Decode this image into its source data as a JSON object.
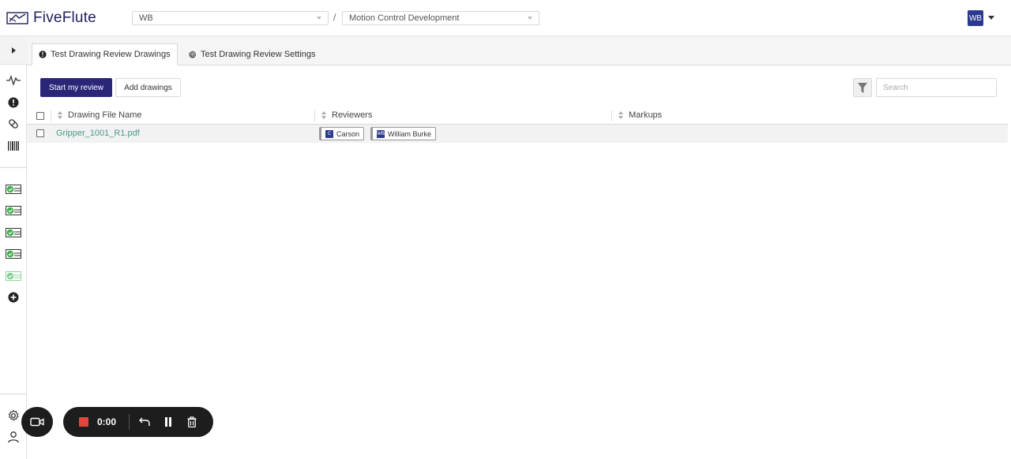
{
  "app": {
    "name": "FiveFlute"
  },
  "header": {
    "org_select": "WB",
    "project_select": "Motion Control Development",
    "separator": "/",
    "user_initials": "WB"
  },
  "tabs": [
    {
      "label": "Test Drawing Review Drawings",
      "icon": "alert-circle-icon",
      "active": true
    },
    {
      "label": "Test Drawing Review Settings",
      "icon": "gear-icon",
      "active": false
    }
  ],
  "toolbar": {
    "start_review_label": "Start my review",
    "add_drawings_label": "Add drawings",
    "search_placeholder": "Search"
  },
  "table": {
    "columns": [
      "Drawing File Name",
      "Reviewers",
      "Markups"
    ],
    "rows": [
      {
        "file": "Gripper_1001_R1.pdf",
        "reviewers": [
          {
            "initials": "C",
            "name": "Carson"
          },
          {
            "initials": "WB",
            "name": "William Burke"
          }
        ],
        "markups": ""
      }
    ]
  },
  "recorder": {
    "time": "0:00"
  },
  "colors": {
    "primary": "#2a2779",
    "link": "#4a9a8a",
    "avatar": "#2b3a8c",
    "record": "#e2453c",
    "status_green": "#3cb04a"
  }
}
